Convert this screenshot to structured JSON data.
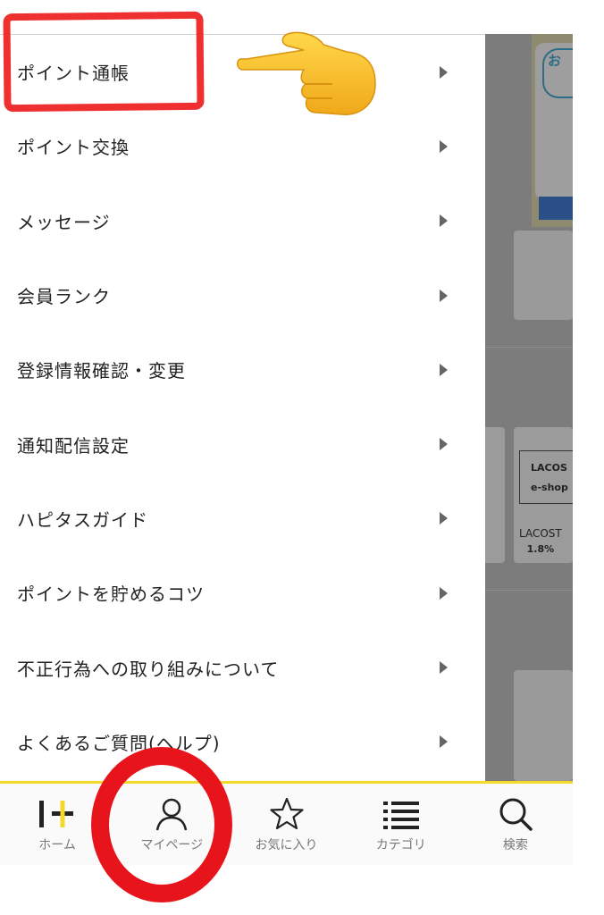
{
  "menu": {
    "items": [
      {
        "label": "ポイント通帳"
      },
      {
        "label": "ポイント交換"
      },
      {
        "label": "メッセージ"
      },
      {
        "label": "会員ランク"
      },
      {
        "label": "登録情報確認・変更"
      },
      {
        "label": "通知配信設定"
      },
      {
        "label": "ハピタスガイド"
      },
      {
        "label": "ポイントを貯めるコツ"
      },
      {
        "label": "不正行為への取り組みについて"
      },
      {
        "label": "よくあるご質問(ヘルプ)"
      }
    ]
  },
  "tabbar": {
    "tabs": [
      {
        "label": "ホーム",
        "icon": "home-logo-icon"
      },
      {
        "label": "マイページ",
        "icon": "person-icon"
      },
      {
        "label": "お気に入り",
        "icon": "star-icon"
      },
      {
        "label": "カテゴリ",
        "icon": "list-icon"
      },
      {
        "label": "検索",
        "icon": "search-icon"
      }
    ]
  },
  "background": {
    "banner_badge": "お",
    "logo_box_text": "LACOS",
    "logo_box_sub": "e-shop",
    "logo_caption": "LACOST",
    "logo_rate": "1.8%"
  },
  "colors": {
    "accent_yellow": "#f2d92a",
    "annotation_red": "#e8141c",
    "text": "#222222",
    "tab_text": "#777777"
  }
}
